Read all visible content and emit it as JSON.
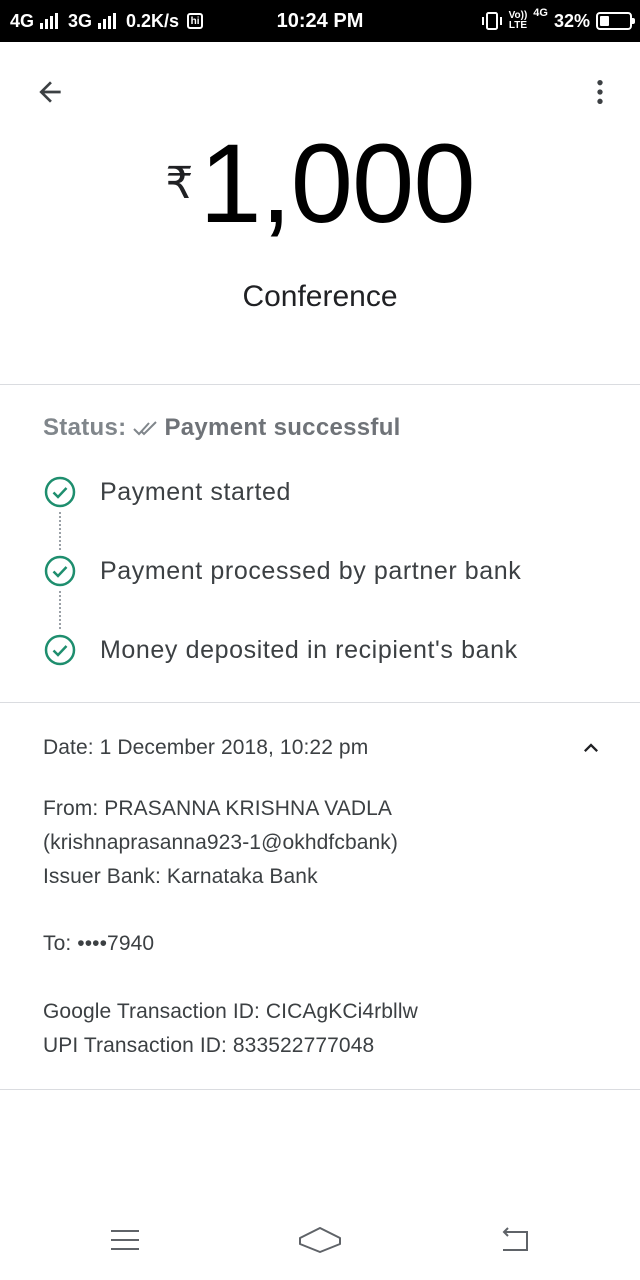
{
  "status_bar": {
    "net1": "4G",
    "net2": "3G",
    "speed": "0.2K/s",
    "hd_badge": "hi",
    "time": "10:24 PM",
    "volte_top": "Vo))",
    "volte_bottom": "LTE",
    "net3": "4G",
    "battery": "32%",
    "battery_level": 0.32
  },
  "header": {
    "back_icon": "arrow-back-icon",
    "menu_icon": "more-vert-icon"
  },
  "payment": {
    "currency_symbol": "₹",
    "amount": "1,000",
    "payee": "Conference"
  },
  "status": {
    "label": "Status:",
    "value": "Payment successful",
    "steps": [
      {
        "label": "Payment started"
      },
      {
        "label": "Payment processed by partner bank"
      },
      {
        "label": "Money deposited in recipient's bank"
      }
    ],
    "accent": "#1e8e6e"
  },
  "details": {
    "date": "Date: 1 December 2018, 10:22 pm",
    "from": "From: PRASANNA KRISHNA VADLA",
    "from_id": "(krishnaprasanna923-1@okhdfcbank)",
    "issuer": "Issuer Bank: Karnataka Bank",
    "to": "To: ••••7940",
    "google_txn": "Google Transaction ID: CICAgKCi4rbllw",
    "upi_txn": "UPI Transaction ID: 833522777048"
  },
  "nav": {
    "menu_icon": "menu-icon",
    "home_icon": "home-icon",
    "back_icon": "nav-back-icon"
  }
}
